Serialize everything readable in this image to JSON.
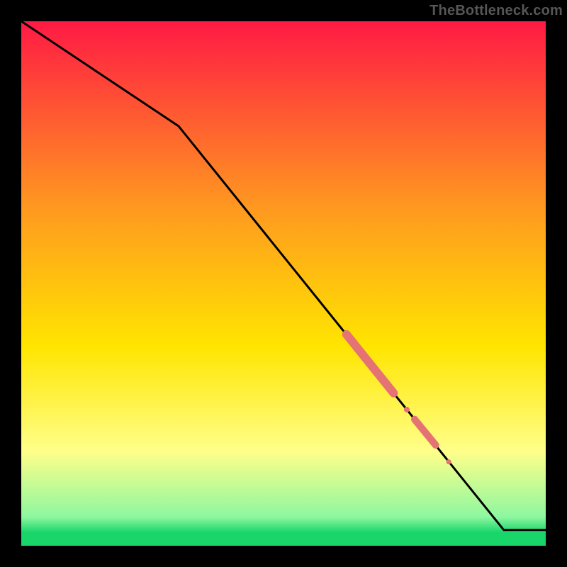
{
  "attribution": "TheBottleneck.com",
  "colors": {
    "accent_marker": "#e57373",
    "line": "#000000",
    "bg_top": "#ff1a44",
    "bg_mid_upper": "#ff9a1f",
    "bg_mid": "#ffe500",
    "bg_lightband": "#ffff8a",
    "bg_green_light": "#8ef7a0",
    "bg_green": "#18d66a",
    "frame": "#000000"
  },
  "chart_data": {
    "type": "line",
    "title": "",
    "xlabel": "",
    "ylabel": "",
    "xlim": [
      0,
      100
    ],
    "ylim": [
      0,
      100
    ],
    "series": [
      {
        "name": "curve",
        "x": [
          0,
          30,
          92,
          100
        ],
        "y": [
          100,
          80,
          3,
          3
        ]
      }
    ],
    "markers": [
      {
        "name": "thick-segment-1",
        "x": [
          62,
          71
        ],
        "y": [
          40.3,
          29.1
        ],
        "width": 12
      },
      {
        "name": "dot-1",
        "x": [
          73.5
        ],
        "y": [
          25.97
        ],
        "width": 8
      },
      {
        "name": "thick-segment-2",
        "x": [
          75,
          79
        ],
        "y": [
          24.1,
          19.2
        ],
        "width": 10
      },
      {
        "name": "dot-2",
        "x": [
          81.5
        ],
        "y": [
          16.0
        ],
        "width": 7
      }
    ],
    "background_bands": [
      {
        "stop": 0.0,
        "color": "bg_top"
      },
      {
        "stop": 0.36,
        "color": "bg_mid_upper"
      },
      {
        "stop": 0.62,
        "color": "bg_mid"
      },
      {
        "stop": 0.82,
        "color": "bg_lightband"
      },
      {
        "stop": 0.945,
        "color": "bg_green_light"
      },
      {
        "stop": 0.975,
        "color": "bg_green"
      },
      {
        "stop": 1.0,
        "color": "bg_green"
      }
    ]
  }
}
